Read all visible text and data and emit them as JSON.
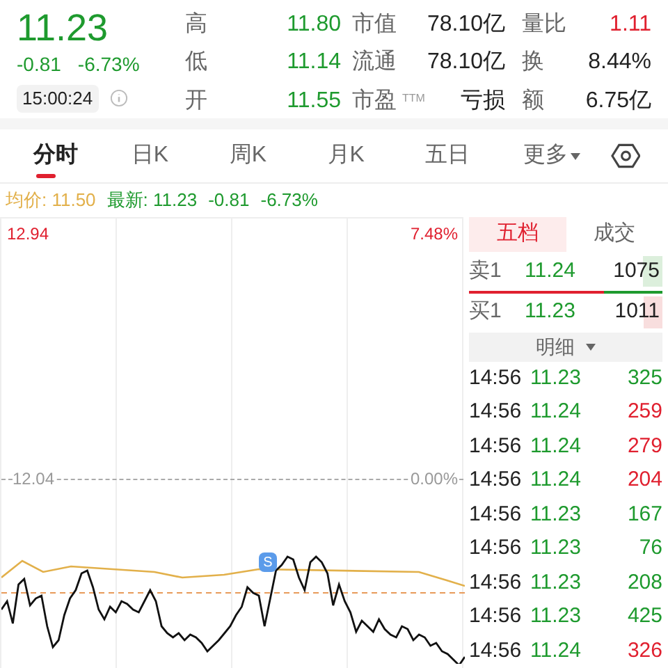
{
  "quote": {
    "price": "11.23",
    "change": "-0.81",
    "change_pct": "-6.73%",
    "time": "15:00:24"
  },
  "stats": [
    {
      "label": "高",
      "value": "11.80",
      "kind": "down"
    },
    {
      "label": "市值",
      "value": "78.10亿",
      "kind": "plain"
    },
    {
      "label": "量比",
      "value": "1.11",
      "kind": "up"
    },
    {
      "label": "低",
      "value": "11.14",
      "kind": "down"
    },
    {
      "label": "流通",
      "value": "78.10亿",
      "kind": "plain"
    },
    {
      "label": "换",
      "value": "8.44%",
      "kind": "plain"
    },
    {
      "label": "开",
      "value": "11.55",
      "kind": "down"
    },
    {
      "label": "市盈",
      "sup": "TTM",
      "value": "亏损",
      "kind": "plain"
    },
    {
      "label": "额",
      "value": "6.75亿",
      "kind": "plain"
    }
  ],
  "tabs": [
    {
      "label": "分时",
      "selected": true
    },
    {
      "label": "日K",
      "selected": false
    },
    {
      "label": "周K",
      "selected": false
    },
    {
      "label": "月K",
      "selected": false
    },
    {
      "label": "五日",
      "selected": false
    },
    {
      "label": "更多",
      "selected": false,
      "dropdown": true
    }
  ],
  "info": {
    "avg": "均价: 11.50",
    "latest": "最新: 11.23",
    "change": "-0.81",
    "change_pct": "-6.73%"
  },
  "chart": {
    "top_price": "12.94",
    "top_pct": "7.48%",
    "mid_price": "12.04",
    "mid_pct": "0.00%",
    "marker": "S"
  },
  "panel_tabs": [
    {
      "label": "五档",
      "selected": true
    },
    {
      "label": "成交",
      "selected": false
    }
  ],
  "orders": [
    {
      "side": "卖1",
      "price": "11.24",
      "volume": "1075",
      "kind": "sell"
    },
    {
      "side": "买1",
      "price": "11.23",
      "volume": "1011",
      "kind": "buy"
    }
  ],
  "detail_button": "明细",
  "trades": [
    {
      "time": "14:56",
      "price": "11.23",
      "volume": "325",
      "color": "#1e9a2e"
    },
    {
      "time": "14:56",
      "price": "11.24",
      "volume": "259",
      "color": "#e0202f"
    },
    {
      "time": "14:56",
      "price": "11.24",
      "volume": "279",
      "color": "#e0202f"
    },
    {
      "time": "14:56",
      "price": "11.24",
      "volume": "204",
      "color": "#e0202f"
    },
    {
      "time": "14:56",
      "price": "11.23",
      "volume": "167",
      "color": "#1e9a2e"
    },
    {
      "time": "14:56",
      "price": "11.23",
      "volume": "76",
      "color": "#1e9a2e"
    },
    {
      "time": "14:56",
      "price": "11.23",
      "volume": "208",
      "color": "#1e9a2e"
    },
    {
      "time": "14:56",
      "price": "11.23",
      "volume": "425",
      "color": "#1e9a2e"
    },
    {
      "time": "14:56",
      "price": "11.24",
      "volume": "326",
      "color": "#e0202f"
    }
  ]
}
